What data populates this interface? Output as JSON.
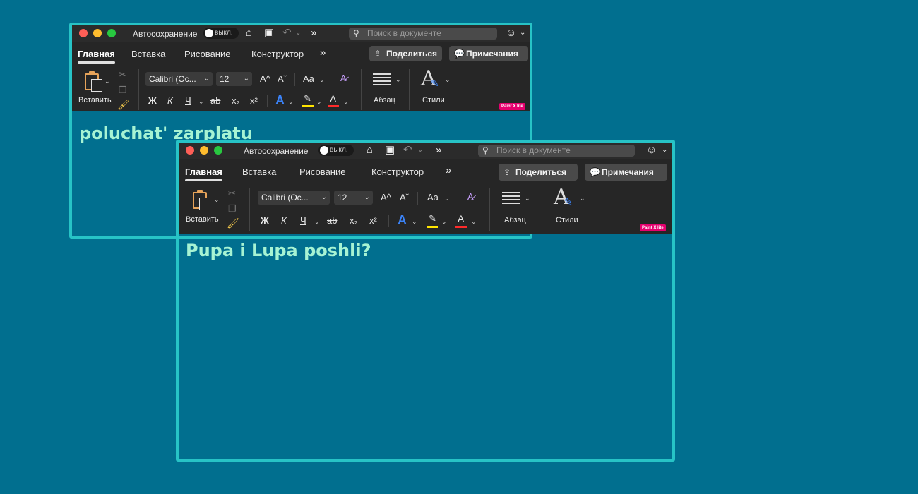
{
  "windows": [
    {
      "titlebar": {
        "autosave_label": "Автосохранение",
        "toggle_label": "выкл.",
        "search_placeholder": "Поиск в документе"
      },
      "tabs": [
        "Главная",
        "Вставка",
        "Рисование",
        "Конструктор"
      ],
      "share_label": "Поделиться",
      "comments_label": "Примечания",
      "paste_label": "Вставить",
      "font_name": "Calibri (Ос...",
      "font_size": "12",
      "paragraph_label": "Абзац",
      "styles_label": "Стили",
      "badge": "Paint X lite",
      "document_text": "poluchat' zarplatu"
    },
    {
      "titlebar": {
        "autosave_label": "Автосохранение",
        "toggle_label": "выкл.",
        "search_placeholder": "Поиск в документе"
      },
      "tabs": [
        "Главная",
        "Вставка",
        "Рисование",
        "Конструктор"
      ],
      "share_label": "Поделиться",
      "comments_label": "Примечания",
      "paste_label": "Вставить",
      "font_name": "Calibri (Ос...",
      "font_size": "12",
      "paragraph_label": "Абзац",
      "styles_label": "Стили",
      "badge": "Paint X lite",
      "document_text": "Pupa i Lupa poshli?"
    }
  ],
  "format_glyphs": {
    "bold": "Ж",
    "italic": "К",
    "underline": "Ч",
    "strike": "ab",
    "subscript": "x₂",
    "superscript": "x²",
    "grow_font": "A^",
    "shrink_font": "Aˇ",
    "change_case": "Aa",
    "text_effects": "A",
    "font_color": "A"
  },
  "icons": {
    "home": "⌂",
    "save": "▣",
    "undo": "↶",
    "more": "»",
    "search": "⚲",
    "smiley": "☺",
    "cut": "✂",
    "copy": "❐",
    "brush": "🖌",
    "share": "⇪",
    "comment": "💬",
    "highlighter": "✎",
    "clear_format": "A̷",
    "chevron": "⌄"
  }
}
